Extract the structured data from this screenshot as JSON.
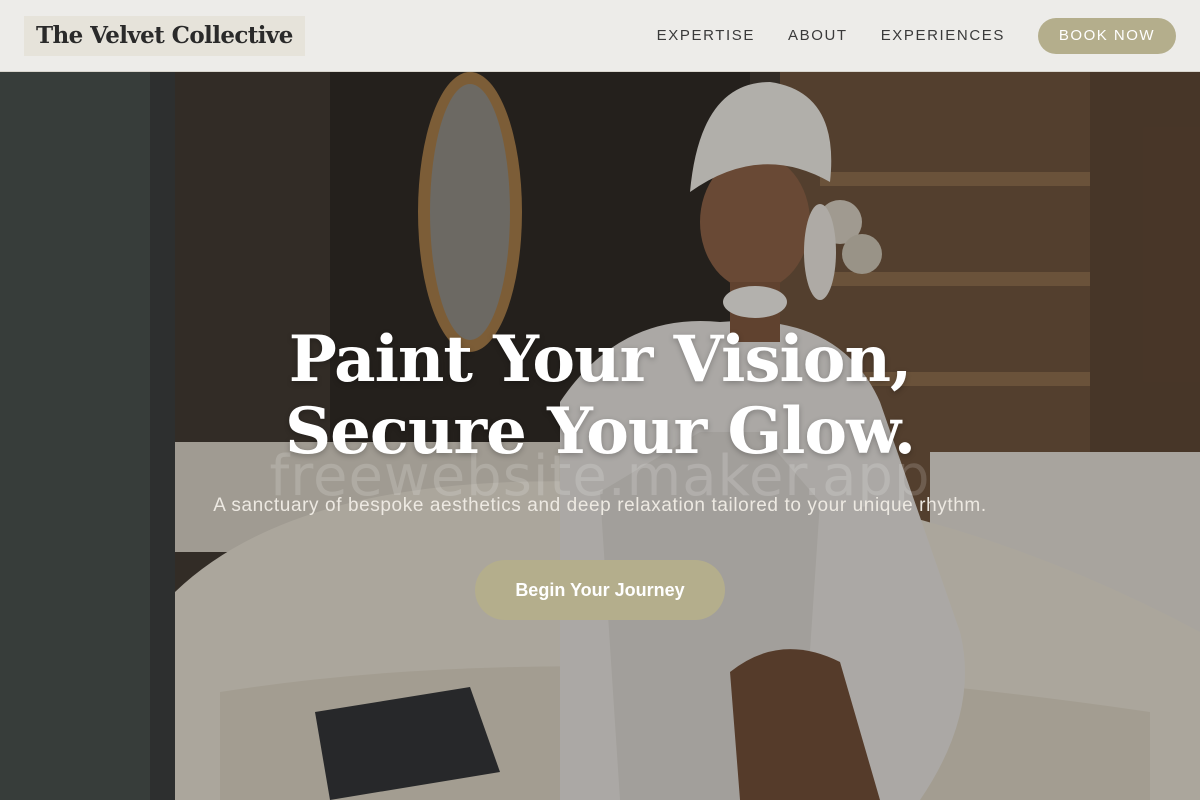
{
  "brand": {
    "name": "The Velvet Collective"
  },
  "nav": {
    "items": [
      {
        "label": "EXPERTISE"
      },
      {
        "label": "ABOUT"
      },
      {
        "label": "EXPERIENCES"
      }
    ],
    "book_label": "BOOK NOW"
  },
  "hero": {
    "headline_line1": "Paint Your Vision,",
    "headline_line2": "Secure Your Glow.",
    "subtitle": "A sanctuary of bespoke aesthetics and deep relaxation tailored to your unique rhythm.",
    "cta_label": "Begin Your Journey",
    "watermark": "freewebsite.maker.app",
    "image_icon": "spa-guest-photo"
  },
  "colors": {
    "accent": "#b4ae8c",
    "header_bg": "#f4f3ef",
    "logo_bg": "#e6e3da",
    "text_dark": "#2a2a2a"
  }
}
